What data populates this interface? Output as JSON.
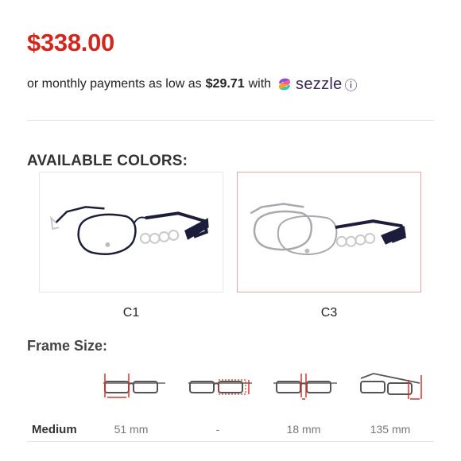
{
  "price": {
    "amount": "$338.00"
  },
  "financing": {
    "prefix": "or monthly payments as low as",
    "amount": "$29.71",
    "with_label": "with",
    "provider_name": "sezzle",
    "info_icon": "info-icon"
  },
  "colors_section": {
    "heading": "AVAILABLE COLORS:",
    "options": [
      {
        "code": "C1",
        "selected": false,
        "frame_color": "#1c1d3a"
      },
      {
        "code": "C3",
        "selected": true,
        "frame_color": "#a8a8ae"
      }
    ]
  },
  "frame_size": {
    "heading": "Frame Size:",
    "measure_icons": [
      "lens-width-icon",
      "lens-height-icon",
      "bridge-width-icon",
      "temple-length-icon"
    ],
    "rows": [
      {
        "name": "Medium",
        "lens_width": "51 mm",
        "lens_height": "-",
        "bridge": "18 mm",
        "temple": "135 mm"
      }
    ]
  },
  "colors": {
    "price_red": "#d0281f",
    "sezzle_purple": "#382757",
    "selected_border": "#e0a9a9",
    "measure_red": "#d9342b"
  }
}
